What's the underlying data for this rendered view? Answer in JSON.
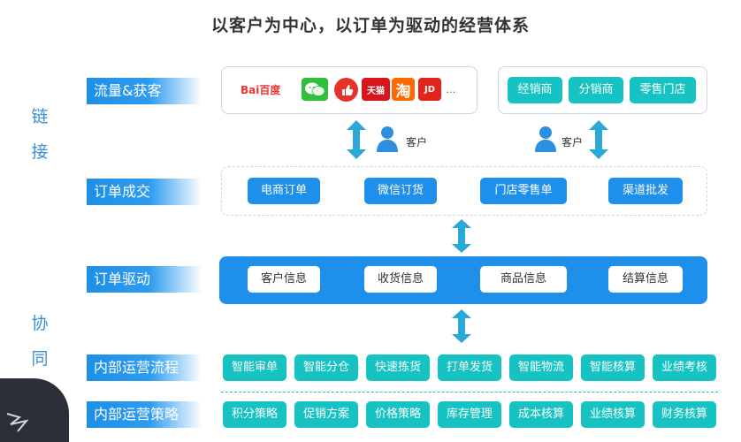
{
  "title": "以客户为中心，以订单为驱动的经营体系",
  "side_labels": {
    "top": [
      "链",
      "接"
    ],
    "bottom": [
      "协",
      "同"
    ]
  },
  "rows": {
    "traffic": "流量&获客",
    "order_deal": "订单成交",
    "order_drive": "订单驱动",
    "internal_flow": "内部运营流程",
    "internal_strategy": "内部运营策略"
  },
  "logos": {
    "baidu": "Bai百度",
    "tmall": "天猫",
    "taobao": "淘",
    "jd": "JD",
    "more": "..."
  },
  "channels": [
    "经销商",
    "分销商",
    "零售门店"
  ],
  "customer_label": "客户",
  "order_types": [
    "电商订单",
    "微信订货",
    "门店零售单",
    "渠道批发"
  ],
  "order_info": [
    "客户信息",
    "收货信息",
    "商品信息",
    "结算信息"
  ],
  "flow_items": [
    "智能审单",
    "智能分仓",
    "快速拣货",
    "打单发货",
    "智能物流",
    "智能核算",
    "业绩考核"
  ],
  "strategy_items": [
    "积分策略",
    "促销方案",
    "价格策略",
    "库存管理",
    "成本核算",
    "业绩核算",
    "财务核算"
  ],
  "colors": {
    "blue": "#1e8fea",
    "teal": "#17c2c2",
    "side": "#3b8fd6"
  }
}
